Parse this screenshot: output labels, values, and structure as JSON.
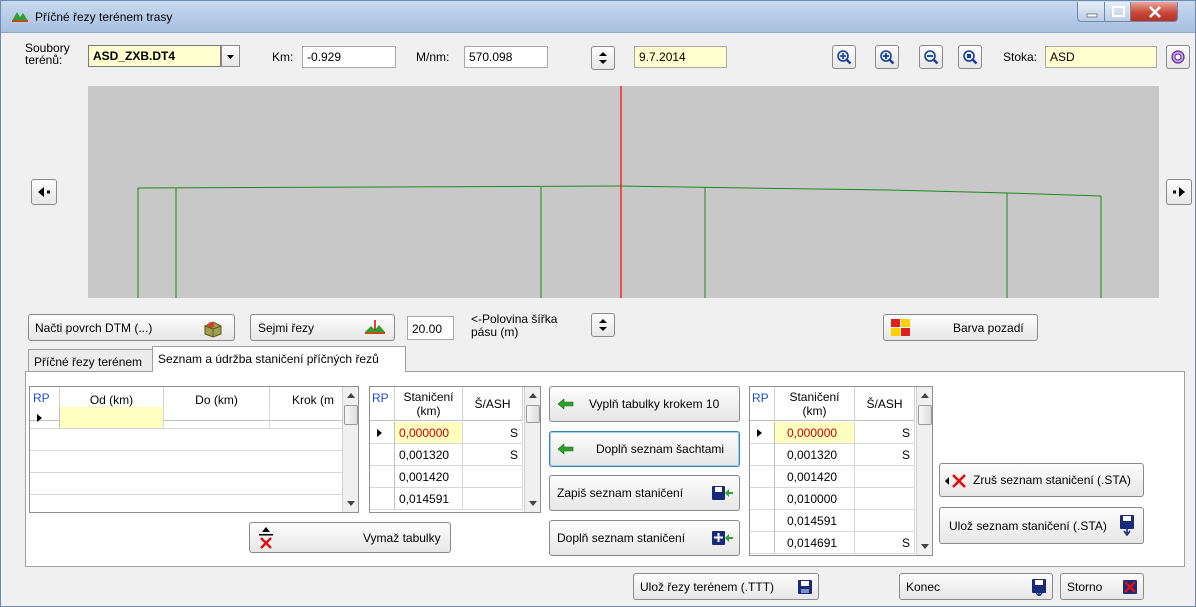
{
  "window": {
    "title": "Příčné řezy terénem trasy"
  },
  "toolbar": {
    "files_label": "Soubory\nterénů:",
    "file_value": "ASD_ZXB.DT4",
    "km_label": "Km:",
    "km_value": "-0.929",
    "mnm_label": "M/nm:",
    "mnm_value": "570.098",
    "date_value": "9.7.2014",
    "stoka_label": "Stoka:",
    "stoka_value": "ASD"
  },
  "controls": {
    "load_dtm": "Načti povrch DTM (...)",
    "take_sections": "Sejmi řezy",
    "half_width_value": "20.00",
    "half_width_label": "<-Polovina šířka\npásu (m)",
    "bg_color": "Barva pozadí"
  },
  "tabs": [
    {
      "label": "Příčné řezy terénem"
    },
    {
      "label": "Seznam a údržba staničení příčných řezů"
    }
  ],
  "grid1": {
    "headers": {
      "rp": "RP",
      "od": "Od (km)",
      "do": "Do (km)",
      "krok": "Krok (m"
    }
  },
  "grid2": {
    "headers": {
      "rp": "RP",
      "stan": "Staničení\n(km)",
      "sash": "Š/ASH"
    },
    "rows": [
      {
        "km": "0,000000",
        "s": "S"
      },
      {
        "km": "0,001320",
        "s": "S"
      },
      {
        "km": "0,001420",
        "s": ""
      },
      {
        "km": "0,014591",
        "s": ""
      }
    ]
  },
  "grid3": {
    "headers": {
      "rp": "RP",
      "stan": "Staničení\n(km)",
      "sash": "Š/ASH"
    },
    "rows": [
      {
        "km": "0,000000",
        "s": "S"
      },
      {
        "km": "0,001320",
        "s": "S"
      },
      {
        "km": "0,001420",
        "s": ""
      },
      {
        "km": "0,010000",
        "s": ""
      },
      {
        "km": "0,014591",
        "s": ""
      },
      {
        "km": "0,014691",
        "s": "S"
      }
    ]
  },
  "buttons": {
    "fill_step": "Vyplň tabulky krokem 10",
    "add_shafts": "Doplň seznam šachtami",
    "write_list": "Zapiš seznam staničení",
    "append_list": "Doplň seznam staničení",
    "clear_tables": "Vymaž tabulky",
    "cancel_list": "Zruš seznam staničení (.STA)",
    "save_list": "Ulož seznam staničení (.STA)",
    "save_sections": "Ulož řezy terénem (.TTT)",
    "end": "Konec",
    "storno": "Storno"
  },
  "colors": {
    "canvas_bg": "#c8c8c8",
    "profile_line": "#1a8a1a",
    "cursor_line": "#ff0000",
    "selected_cell_text": "#d00000",
    "selected_cell_bg": "#ffffc0",
    "yellow_field": "#ffffd0"
  }
}
